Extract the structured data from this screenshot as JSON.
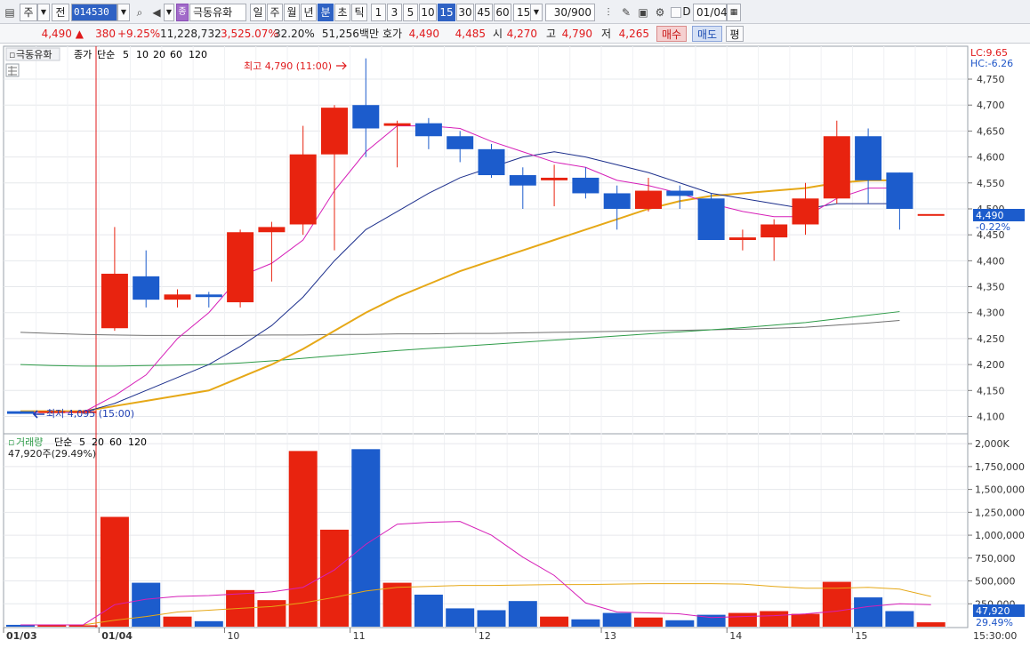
{
  "toolbar": {
    "market": "주",
    "scope": "전",
    "code": "014530",
    "stock_name": "극동유화",
    "stock_badge": "종",
    "periods": [
      {
        "label": "일",
        "selected": false
      },
      {
        "label": "주",
        "selected": false
      },
      {
        "label": "월",
        "selected": false
      },
      {
        "label": "년",
        "selected": false
      },
      {
        "label": "분",
        "selected": true
      },
      {
        "label": "초",
        "selected": false
      },
      {
        "label": "틱",
        "selected": false
      }
    ],
    "intervals": [
      {
        "label": "1",
        "selected": false
      },
      {
        "label": "3",
        "selected": false
      },
      {
        "label": "5",
        "selected": false
      },
      {
        "label": "10",
        "selected": false
      },
      {
        "label": "15",
        "selected": true
      },
      {
        "label": "30",
        "selected": false
      },
      {
        "label": "45",
        "selected": false
      },
      {
        "label": "60",
        "selected": false
      }
    ],
    "interval_value": "15",
    "count": "30/900",
    "d_label": "D",
    "date": "01/04"
  },
  "quote": {
    "price": "4,490",
    "change": "380",
    "change_pct": "+9.25%",
    "volume": "11,228,732",
    "volume_ratio": "3,525.07%",
    "turnover": "32.20%",
    "amount": "51,256백만",
    "bid_label": "호가",
    "ask": "4,490",
    "bid": "4,485",
    "open_label": "시",
    "open": "4,270",
    "high_label": "고",
    "high": "4,790",
    "low_label": "저",
    "low": "4,265",
    "buy_label": "매수",
    "sell_label": "매도",
    "flat_label": "평"
  },
  "price_panel": {
    "title": "극동유화",
    "legend": [
      {
        "text": "종가",
        "color": "#d61fb8"
      },
      {
        "text": "단순",
        "color": "#d61fb8"
      },
      {
        "text": "5",
        "color": "#d61fb8"
      },
      {
        "text": "10",
        "color": "#1c2f8c"
      },
      {
        "text": "20",
        "color": "#e6a817"
      },
      {
        "text": "60",
        "color": "#2e9b48"
      },
      {
        "text": "120",
        "color": "#707070"
      }
    ],
    "high_marker": "최고 4,790 (11:00)",
    "low_marker": "최저 4,095 (15:00)",
    "lc": "LC:9.65",
    "hc": "HC:-6.26",
    "last_price": "4,490",
    "last_change": "-0.22%"
  },
  "volume_panel": {
    "title": "거래량",
    "legend": [
      {
        "text": "단순",
        "color": "#d61fb8"
      },
      {
        "text": "5",
        "color": "#d61fb8"
      },
      {
        "text": "20",
        "color": "#e6a817"
      },
      {
        "text": "60",
        "color": "#2e9b48"
      },
      {
        "text": "120",
        "color": "#707070"
      }
    ],
    "info": "47,920주(29.49%)",
    "last_volume": "47,920",
    "last_volume_pct": "29.49%"
  },
  "colors": {
    "up": "#e8230f",
    "down": "#1c5ccc",
    "ma5": "#d61fb8",
    "ma10": "#1c2f8c",
    "ma20": "#e6a817",
    "ma60": "#2e9b48",
    "ma120": "#707070"
  },
  "chart_data": {
    "type": "candlestick",
    "price_axis": {
      "ticks": [
        4100,
        4150,
        4200,
        4250,
        4300,
        4350,
        4400,
        4450,
        4500,
        4550,
        4600,
        4650,
        4700,
        4750
      ],
      "labels": [
        "4,100",
        "4,150",
        "4,200",
        "4,250",
        "4,300",
        "4,350",
        "4,400",
        "4,450",
        "4,500",
        "4,550",
        "4,600",
        "4,650",
        "4,700",
        "4,750"
      ],
      "ylim": [
        4070,
        4810
      ]
    },
    "volume_axis": {
      "ticks": [
        250000,
        500000,
        750000,
        1000000,
        1250000,
        1500000,
        1750000,
        2000000
      ],
      "labels": [
        "250,000",
        "500,000",
        "750,000",
        "1,000,000",
        "1,250,000",
        "1,500,000",
        "1,750,000",
        "2,000K"
      ],
      "ylim": [
        0,
        2050000
      ]
    },
    "date_labels": [
      {
        "text": "01/03",
        "bar": 0
      },
      {
        "text": "01/04",
        "bar": 3
      },
      {
        "text": "10",
        "bar": 7
      },
      {
        "text": "11",
        "bar": 11
      },
      {
        "text": "12",
        "bar": 15
      },
      {
        "text": "13",
        "bar": 19
      },
      {
        "text": "14",
        "bar": 23
      },
      {
        "text": "15",
        "bar": 27
      }
    ],
    "time_label": "15:30:00",
    "candles": [
      {
        "o": 4110,
        "h": 4110,
        "l": 4105,
        "c": 4105,
        "v": 20000
      },
      {
        "o": 4110,
        "h": 4112,
        "l": 4105,
        "c": 4110,
        "v": 15000
      },
      {
        "o": 4110,
        "h": 4112,
        "l": 4105,
        "c": 4110,
        "v": 15000
      },
      {
        "o": 4270,
        "h": 4465,
        "l": 4265,
        "c": 4375,
        "v": 1200000
      },
      {
        "o": 4370,
        "h": 4420,
        "l": 4310,
        "c": 4325,
        "v": 480000
      },
      {
        "o": 4325,
        "h": 4345,
        "l": 4310,
        "c": 4335,
        "v": 110000
      },
      {
        "o": 4335,
        "h": 4340,
        "l": 4310,
        "c": 4330,
        "v": 60000
      },
      {
        "o": 4320,
        "h": 4460,
        "l": 4310,
        "c": 4455,
        "v": 400000
      },
      {
        "o": 4455,
        "h": 4475,
        "l": 4360,
        "c": 4465,
        "v": 290000
      },
      {
        "o": 4470,
        "h": 4660,
        "l": 4450,
        "c": 4605,
        "v": 1920000
      },
      {
        "o": 4605,
        "h": 4700,
        "l": 4420,
        "c": 4695,
        "v": 1060000
      },
      {
        "o": 4700,
        "h": 4790,
        "l": 4600,
        "c": 4655,
        "v": 1940000
      },
      {
        "o": 4660,
        "h": 4670,
        "l": 4580,
        "c": 4665,
        "v": 480000
      },
      {
        "o": 4665,
        "h": 4675,
        "l": 4615,
        "c": 4640,
        "v": 350000
      },
      {
        "o": 4640,
        "h": 4650,
        "l": 4590,
        "c": 4615,
        "v": 200000
      },
      {
        "o": 4615,
        "h": 4625,
        "l": 4560,
        "c": 4565,
        "v": 180000
      },
      {
        "o": 4565,
        "h": 4580,
        "l": 4500,
        "c": 4545,
        "v": 280000
      },
      {
        "o": 4555,
        "h": 4585,
        "l": 4505,
        "c": 4560,
        "v": 110000
      },
      {
        "o": 4560,
        "h": 4580,
        "l": 4520,
        "c": 4530,
        "v": 80000
      },
      {
        "o": 4530,
        "h": 4545,
        "l": 4460,
        "c": 4500,
        "v": 150000
      },
      {
        "o": 4500,
        "h": 4560,
        "l": 4495,
        "c": 4535,
        "v": 100000
      },
      {
        "o": 4535,
        "h": 4545,
        "l": 4500,
        "c": 4525,
        "v": 70000
      },
      {
        "o": 4520,
        "h": 4530,
        "l": 4440,
        "c": 4440,
        "v": 130000
      },
      {
        "o": 4440,
        "h": 4460,
        "l": 4420,
        "c": 4445,
        "v": 150000
      },
      {
        "o": 4445,
        "h": 4480,
        "l": 4400,
        "c": 4470,
        "v": 170000
      },
      {
        "o": 4470,
        "h": 4550,
        "l": 4450,
        "c": 4520,
        "v": 140000
      },
      {
        "o": 4520,
        "h": 4670,
        "l": 4510,
        "c": 4640,
        "v": 490000
      },
      {
        "o": 4640,
        "h": 4655,
        "l": 4510,
        "c": 4555,
        "v": 320000
      },
      {
        "o": 4570,
        "h": 4570,
        "l": 4460,
        "c": 4500,
        "v": 170000
      },
      {
        "o": 4490,
        "h": 4490,
        "l": 4490,
        "c": 4490,
        "v": 47920
      }
    ],
    "ma5": [
      4108,
      4108,
      4108,
      4140,
      4180,
      4250,
      4300,
      4370,
      4395,
      4440,
      4535,
      4610,
      4660,
      4660,
      4655,
      4630,
      4610,
      4590,
      4580,
      4555,
      4545,
      4530,
      4510,
      4495,
      4485,
      4485,
      4520,
      4540,
      4540
    ],
    "ma10": [
      4108,
      4108,
      4108,
      4125,
      4150,
      4175,
      4200,
      4235,
      4275,
      4330,
      4400,
      4460,
      4495,
      4530,
      4560,
      4580,
      4600,
      4610,
      4600,
      4585,
      4570,
      4550,
      4530,
      4520,
      4510,
      4500,
      4510,
      4510,
      4510
    ],
    "ma20": [
      4110,
      4110,
      4110,
      4120,
      4130,
      4140,
      4150,
      4175,
      4200,
      4230,
      4265,
      4300,
      4330,
      4355,
      4380,
      4400,
      4420,
      4440,
      4460,
      4480,
      4500,
      4515,
      4525,
      4530,
      4535,
      4540,
      4550,
      4555,
      4555
    ],
    "ma60": [
      4200,
      4198,
      4197,
      4197,
      4198,
      4199,
      4200,
      4203,
      4207,
      4212,
      4217,
      4222,
      4227,
      4231,
      4235,
      4239,
      4243,
      4247,
      4251,
      4255,
      4259,
      4263,
      4267,
      4271,
      4276,
      4281,
      4288,
      4295,
      4302
    ],
    "ma120": [
      4262,
      4260,
      4258,
      4257,
      4256,
      4256,
      4256,
      4256,
      4257,
      4257,
      4258,
      4258,
      4259,
      4259,
      4260,
      4260,
      4261,
      4262,
      4263,
      4264,
      4265,
      4266,
      4267,
      4268,
      4270,
      4272,
      4276,
      4280,
      4285
    ],
    "vma5": [
      20000,
      20000,
      20000,
      240000,
      300000,
      330000,
      340000,
      360000,
      380000,
      430000,
      620000,
      900000,
      1120000,
      1140000,
      1150000,
      1000000,
      760000,
      560000,
      260000,
      160000,
      150000,
      140000,
      100000,
      110000,
      120000,
      140000,
      170000,
      220000,
      250000,
      240000
    ],
    "vma20": [
      20000,
      20000,
      20000,
      70000,
      110000,
      160000,
      180000,
      200000,
      220000,
      260000,
      320000,
      390000,
      430000,
      440000,
      450000,
      450000,
      455000,
      460000,
      460000,
      465000,
      470000,
      470000,
      470000,
      465000,
      440000,
      420000,
      420000,
      430000,
      410000,
      330000
    ]
  }
}
